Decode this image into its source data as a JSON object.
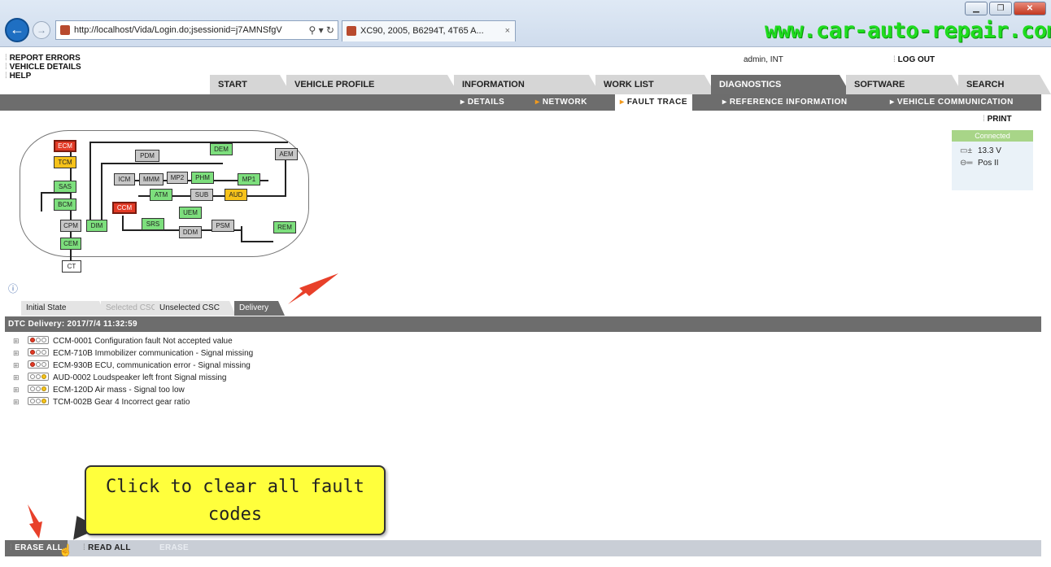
{
  "browser": {
    "address": "http://localhost/Vida/Login.do;jsessionid=j7AMNSfgV",
    "addr_host": "localhost",
    "addr_icons": "⚲ ▾ ↻",
    "tab_title": "XC90, 2005, B6294T, 4T65 A...",
    "tab_close": "×",
    "watermark": "www.car-auto-repair.com",
    "win_minimize": "▁",
    "win_restore": "❐",
    "win_close": "✕"
  },
  "header": {
    "links": [
      "REPORT ERRORS",
      "VEHICLE DETAILS",
      "HELP"
    ],
    "user": "admin, INT",
    "logout": "LOG OUT"
  },
  "main_nav": [
    "START",
    "VEHICLE PROFILE",
    "INFORMATION",
    "WORK LIST",
    "DIAGNOSTICS",
    "SOFTWARE",
    "SEARCH"
  ],
  "sub_nav": [
    "DETAILS",
    "NETWORK",
    "FAULT TRACE",
    "REFERENCE INFORMATION",
    "VEHICLE COMMUNICATION"
  ],
  "print": "PRINT",
  "status": {
    "connection": "Connected",
    "voltage": "13.3 V",
    "key_position": "Pos II",
    "battery_icon": "battery-icon",
    "key_icon": "key-icon"
  },
  "network_nodes": [
    "ECM",
    "TCM",
    "PDM",
    "DEM",
    "AEM",
    "ICM",
    "MMM",
    "MP2",
    "PHM",
    "MP1",
    "SAS",
    "ATM",
    "SUB",
    "AUD",
    "BCM",
    "CCM",
    "UEM",
    "SRS",
    "DDM",
    "PSM",
    "CPM",
    "DIM",
    "REM",
    "CEM",
    "CT"
  ],
  "dtc_tabs": [
    "Initial State",
    "Selected CSC",
    "Unselected CSC",
    "Delivery"
  ],
  "dtc_header": "DTC Delivery: 2017/7/4 11:32:59",
  "dtc_list": [
    {
      "lamp": "red",
      "text": "CCM-0001 Configuration fault Not accepted value"
    },
    {
      "lamp": "red",
      "text": "ECM-710B Immobilizer communication - Signal missing"
    },
    {
      "lamp": "red",
      "text": "ECM-930B ECU, communication error - Signal missing"
    },
    {
      "lamp": "yellow",
      "text": "AUD-0002 Loudspeaker left front Signal missing"
    },
    {
      "lamp": "yellow",
      "text": "ECM-120D Air mass - Signal too low"
    },
    {
      "lamp": "yellow",
      "text": "TCM-002B Gear 4 Incorrect gear ratio"
    }
  ],
  "callout": {
    "line1": "Click to clear all fault",
    "line2": "codes"
  },
  "bottom_bar": {
    "erase_all": "ERASE ALL",
    "read_all": "READ ALL",
    "erase": "ERASE"
  },
  "colors": {
    "accent_red": "#e23a26",
    "arrow_red": "#e8402a",
    "callout_yellow": "#ffff3c",
    "node_green": "#7ddf7d",
    "node_yellow": "#f6c21a",
    "bar_grey": "#6d6d6d"
  }
}
